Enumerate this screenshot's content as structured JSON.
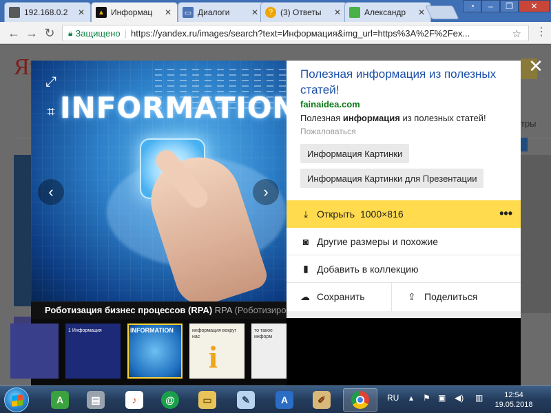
{
  "browser": {
    "tabs": [
      {
        "title": "192.168.0.2",
        "favicon_color": "#5a5a5a",
        "favicon_text": "",
        "active": false
      },
      {
        "title": "Информац",
        "favicon_color": "#f4b400",
        "favicon_text": "",
        "active": true
      },
      {
        "title": "Диалоги",
        "favicon_color": "#4b73b6",
        "favicon_text": "",
        "active": false
      },
      {
        "title": "(3) Ответы",
        "favicon_color": "#f0a500",
        "favicon_text": "?",
        "active": false
      },
      {
        "title": "Александр",
        "favicon_color": "#49b04a",
        "favicon_text": "",
        "active": false
      }
    ],
    "address": {
      "lock_icon": "lock-icon",
      "security_label": "Защищено",
      "url": "https://yandex.ru/images/search?text=Информация&img_url=https%3A%2F%2Fex..."
    }
  },
  "page": {
    "logo_letters": "Ян",
    "right_label": "тры"
  },
  "viewer": {
    "image_word": "INFORMATION",
    "caption_bold": "Роботизация бизнес процессов (RPA)",
    "caption_rpa": "RPA",
    "caption_muted": "(Роботизирова",
    "thumbnails": [
      {
        "title": "",
        "color": "#3a3f8c",
        "selected": false
      },
      {
        "title": "1 Информация",
        "color": "#1d2a78",
        "selected": false
      },
      {
        "title": "INFORMATION",
        "color": "#1f6fbf",
        "selected": true
      },
      {
        "title": "информация вокруг нас",
        "color": "#f4f1e6",
        "selected": false
      },
      {
        "title": "то такое информ",
        "color": "#eeeeee",
        "selected": false
      }
    ]
  },
  "panel": {
    "title": "Полезная информация из полезных статей!",
    "domain": "fainaidea.com",
    "desc_before": "Полезная ",
    "desc_bold": "информация",
    "desc_after": " из полезных статей!",
    "complain": "Пожаловаться",
    "tags": [
      "Информация Картинки",
      "Информация Картинки для Презентации"
    ],
    "open_label": "Открыть",
    "open_size": "1000×816",
    "other_sizes": "Другие размеры и похожие",
    "add_collection": "Добавить в коллекцию",
    "save": "Сохранить",
    "share": "Поделиться"
  },
  "taskbar": {
    "language": "RU",
    "time": "12:54",
    "date": "19.05.2018",
    "apps": [
      {
        "name": "aimp",
        "color": "#3aa23e",
        "glyph": "A",
        "active": false
      },
      {
        "name": "newspaper",
        "color": "#9aa3ad",
        "glyph": "▤",
        "active": false
      },
      {
        "name": "music",
        "color": "#ffffff",
        "glyph": "♪",
        "active": false
      },
      {
        "name": "mail-agent",
        "color": "#1aa04a",
        "glyph": "@",
        "active": false
      },
      {
        "name": "explorer",
        "color": "#e8c35a",
        "glyph": "▭",
        "active": false
      },
      {
        "name": "notepad",
        "color": "#b9d4ec",
        "glyph": "✎",
        "active": false
      },
      {
        "name": "wordpad",
        "color": "#2b6cc4",
        "glyph": "A",
        "active": false
      },
      {
        "name": "paint",
        "color": "#d9b97a",
        "glyph": "✐",
        "active": false
      },
      {
        "name": "chrome",
        "color": "#e34133",
        "glyph": "◉",
        "active": true
      }
    ]
  },
  "colors": {
    "accent_yellow": "#ffdb4d",
    "link_blue": "#1a4fa8",
    "domain_green": "#0b7a18"
  }
}
